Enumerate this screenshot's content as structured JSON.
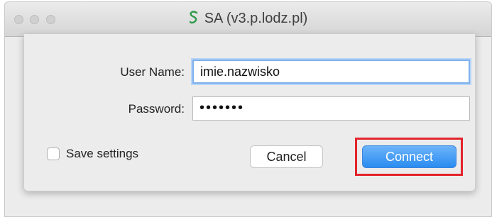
{
  "window": {
    "title": "SA (v3.p.lodz.pl)",
    "icon": "sa-app-icon"
  },
  "form": {
    "username_label": "User Name:",
    "username_value": "imie.nazwisko",
    "password_label": "Password:",
    "password_value": "•••••••",
    "save_settings_label": "Save settings",
    "save_settings_checked": false
  },
  "buttons": {
    "cancel_label": "Cancel",
    "connect_label": "Connect"
  },
  "colors": {
    "primary_button": "#2a8cf0",
    "highlight": "#e3242b",
    "focus_ring": "#7fb0ec"
  }
}
